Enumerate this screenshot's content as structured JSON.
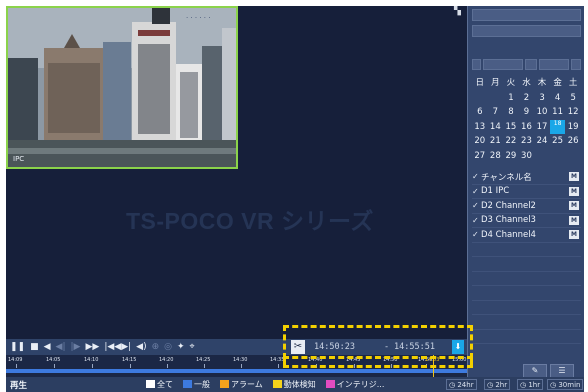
{
  "camera": {
    "label": "IPC"
  },
  "watermark": "TS-POCO VR シリーズ",
  "calendar": {
    "weekdays": [
      "日",
      "月",
      "火",
      "水",
      "木",
      "金",
      "土"
    ],
    "weeks": [
      [
        "",
        "",
        "1",
        "2",
        "3",
        "4",
        "5"
      ],
      [
        "6",
        "7",
        "8",
        "9",
        "10",
        "11",
        "12"
      ],
      [
        "13",
        "14",
        "15",
        "16",
        "17",
        "18",
        "19"
      ],
      [
        "20",
        "21",
        "22",
        "23",
        "24",
        "25",
        "26"
      ],
      [
        "27",
        "28",
        "29",
        "30",
        "",
        "",
        ""
      ]
    ],
    "selected_day": "18"
  },
  "channels": {
    "header": "チャンネル名",
    "items": [
      {
        "name": "D1 IPC"
      },
      {
        "name": "D2 Channel2"
      },
      {
        "name": "D3 Channel3"
      },
      {
        "name": "D4 Channel4"
      }
    ]
  },
  "playback": {
    "clip_start": "14:50:23",
    "clip_separator": "-",
    "clip_end": "14:55:51"
  },
  "timeline": {
    "ticks": [
      "14:09",
      "14:05",
      "14:10",
      "14:15",
      "14:20",
      "14:25",
      "14:30",
      "14:35",
      "14:40",
      "14:45",
      "14:50",
      "14:55",
      "15:00"
    ],
    "current_marker": "14:53"
  },
  "bottom": {
    "mode_label": "再生",
    "legend": [
      {
        "label": "全て",
        "color": "#ffffff"
      },
      {
        "label": "一般",
        "color": "#3d7adf"
      },
      {
        "label": "アラーム",
        "color": "#f4a21c"
      },
      {
        "label": "動体検知",
        "color": "#f4d31c"
      },
      {
        "label": "インテリジ...",
        "color": "#e24cc0"
      }
    ],
    "zoom": [
      "24hr",
      "2hr",
      "1hr",
      "30min"
    ]
  },
  "colors": {
    "background": "#161f3a",
    "panel": "#33466d",
    "accent": "#1aa7e8",
    "highlight": "#f3d000",
    "record": "#3d7adf"
  }
}
